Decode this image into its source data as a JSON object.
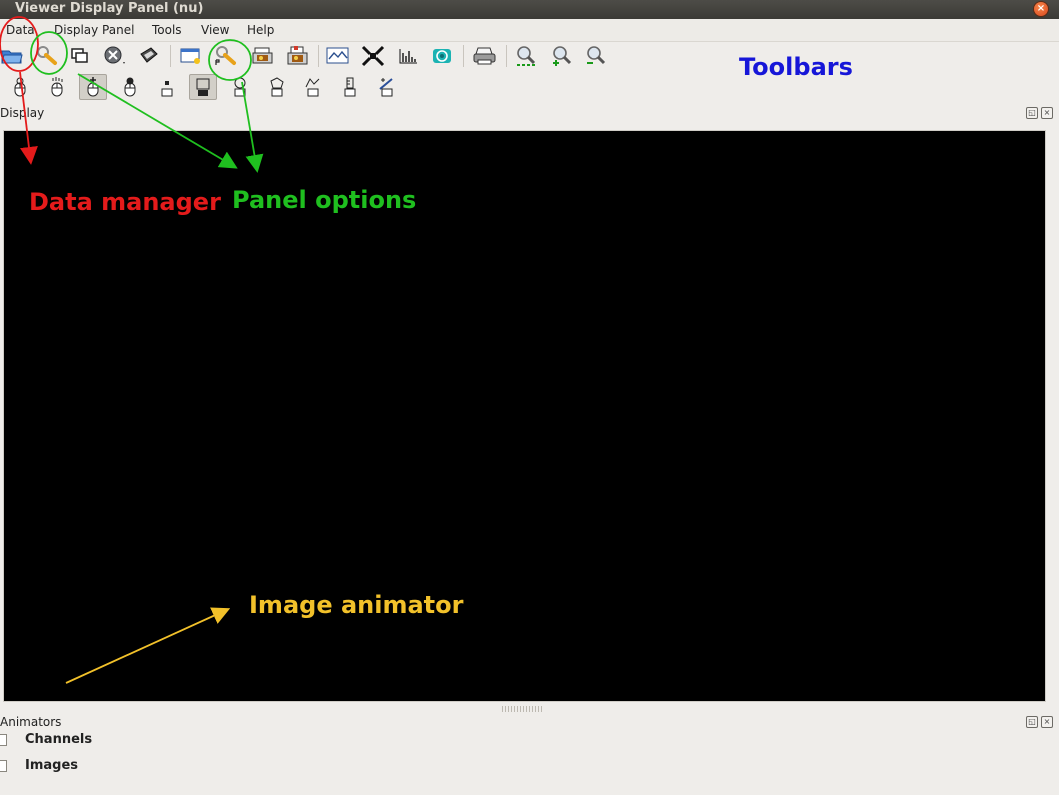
{
  "window": {
    "title": "Viewer Display Panel (nu)",
    "close_glyph": "×"
  },
  "menubar": [
    {
      "label": "Data"
    },
    {
      "label": "Display Panel"
    },
    {
      "label": "Tools"
    },
    {
      "label": "View"
    },
    {
      "label": "Help"
    }
  ],
  "toolbar1": [
    {
      "icon": "folder-open-icon"
    },
    {
      "icon": "wrench-icon"
    },
    {
      "icon": "new-window-icon"
    },
    {
      "icon": "close-circle-icon"
    },
    {
      "icon": "save-icon"
    },
    {
      "icon": "panel-add-icon"
    },
    {
      "icon": "panel-options-icon"
    },
    {
      "icon": "image-print-icon"
    },
    {
      "icon": "image-export-icon"
    },
    {
      "icon": "profile-icon"
    },
    {
      "icon": "shrink-icon"
    },
    {
      "icon": "histogram-icon"
    },
    {
      "icon": "target-icon"
    },
    {
      "icon": "printer-icon"
    },
    {
      "icon": "zoom-fit-icon"
    },
    {
      "icon": "zoom-in-icon"
    },
    {
      "icon": "zoom-out-icon"
    }
  ],
  "toolbar2": [
    {
      "icon": "mouse-zoom-icon"
    },
    {
      "icon": "mouse-pan-icon"
    },
    {
      "icon": "mouse-crosshair-icon",
      "pressed": true
    },
    {
      "icon": "mouse-contrast-icon"
    },
    {
      "icon": "mouse-point-icon"
    },
    {
      "icon": "mouse-rectangle-icon",
      "pressed": true
    },
    {
      "icon": "mouse-ellipse-icon"
    },
    {
      "icon": "mouse-polygon-icon"
    },
    {
      "icon": "mouse-polyline-icon"
    },
    {
      "icon": "mouse-ruler-icon"
    },
    {
      "icon": "mouse-positioner-icon"
    }
  ],
  "display_dock": {
    "title": "Display"
  },
  "animators_dock": {
    "title": "Animators",
    "items": [
      {
        "label": "Channels"
      },
      {
        "label": "Images"
      }
    ]
  },
  "annotations": {
    "toolbars": "Toolbars",
    "data_manager": "Data manager",
    "panel_options": "Panel options",
    "image_animator": "Image animator"
  },
  "colors": {
    "annotation_blue": "#1616d8",
    "annotation_red": "#e41b1b",
    "annotation_green": "#1fbf1f",
    "annotation_yellow": "#f2c12a",
    "canvas": "#000000"
  }
}
